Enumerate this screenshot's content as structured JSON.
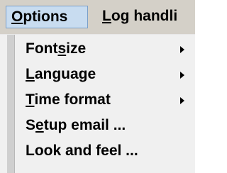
{
  "menubar": {
    "options": {
      "before": "",
      "mnemonic": "O",
      "after": "ptions"
    },
    "log_handling": {
      "before": "",
      "mnemonic": "L",
      "after": "og handli"
    }
  },
  "menu": {
    "items": [
      {
        "before": "Font",
        "mnemonic": "s",
        "after": "ize",
        "has_submenu": true
      },
      {
        "before": "",
        "mnemonic": "L",
        "after": "anguage",
        "has_submenu": true
      },
      {
        "before": "",
        "mnemonic": "T",
        "after": "ime format",
        "has_submenu": true
      },
      {
        "before": "S",
        "mnemonic": "e",
        "after": "tup email ...",
        "has_submenu": false
      },
      {
        "before": "Look and feel ...",
        "mnemonic": "",
        "after": "",
        "has_submenu": false
      }
    ]
  },
  "colors": {
    "menubar_bg": "#d4d0c8",
    "selected_bg": "#c8dcf0",
    "selected_border": "#7a9ec8",
    "dropdown_bg": "#f0f0f0",
    "gutter_bg": "#cfcfcf"
  },
  "icons": {
    "submenu": "submenu-arrow-icon"
  }
}
